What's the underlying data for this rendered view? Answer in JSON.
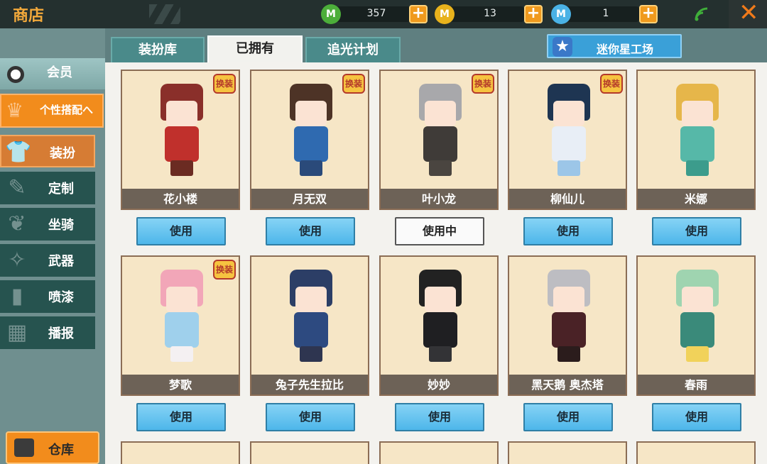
{
  "header": {
    "title": "商店",
    "currencies": [
      {
        "icon": "green-gem-icon",
        "symbol": "M",
        "value": "357",
        "color": "#4cae3a"
      },
      {
        "icon": "gold-coin-icon",
        "symbol": "M",
        "value": "13",
        "color": "#e8b21c"
      },
      {
        "icon": "blue-coin-icon",
        "symbol": "M",
        "value": "1",
        "color": "#4ab2e6"
      }
    ],
    "plus_label": "+",
    "close_label": "✕"
  },
  "sidebar": {
    "member_label": "会员",
    "group_label": "个性搭配へ",
    "items": [
      {
        "label": "装扮",
        "icon": "t-shirt-icon",
        "glyph": "👕"
      },
      {
        "label": "定制",
        "icon": "tools-icon",
        "glyph": "✎"
      },
      {
        "label": "坐骑",
        "icon": "mount-icon",
        "glyph": "❦"
      },
      {
        "label": "武器",
        "icon": "gun-icon",
        "glyph": "✧"
      },
      {
        "label": "喷漆",
        "icon": "spray-can-icon",
        "glyph": "▮"
      },
      {
        "label": "播报",
        "icon": "broadcast-icon",
        "glyph": "▦"
      }
    ],
    "warehouse_label": "仓库"
  },
  "tabs": [
    {
      "label": "装扮库",
      "active": false
    },
    {
      "label": "已拥有",
      "active": true
    },
    {
      "label": "追光计划",
      "active": false
    }
  ],
  "mini_star_button": {
    "label": "迷你星工场",
    "glyph": "★"
  },
  "badge_text": "换装",
  "skins": [
    {
      "name": "花小楼",
      "button": "使用",
      "in_use": false,
      "badge": true,
      "hair": "#8a2f2a",
      "body": "#c0302c",
      "legs": "#6b2b22"
    },
    {
      "name": "月无双",
      "button": "使用",
      "in_use": false,
      "badge": true,
      "hair": "#4d3326",
      "body": "#2f6ab0",
      "legs": "#2a4a7a"
    },
    {
      "name": "叶小龙",
      "button": "使用中",
      "in_use": true,
      "badge": true,
      "hair": "#a8a8ab",
      "body": "#3f3b38",
      "legs": "#4a4540"
    },
    {
      "name": "柳仙儿",
      "button": "使用",
      "in_use": false,
      "badge": true,
      "hair": "#1e3552",
      "body": "#e8eef6",
      "legs": "#9cc6e8"
    },
    {
      "name": "米娜",
      "button": "使用",
      "in_use": false,
      "badge": false,
      "hair": "#e6b64a",
      "body": "#56b8a8",
      "legs": "#3c9c8c"
    },
    {
      "name": "梦歌",
      "button": "使用",
      "in_use": false,
      "badge": true,
      "hair": "#f2a6b8",
      "body": "#9fd0ec",
      "legs": "#f4f0f2"
    },
    {
      "name": "兔子先生拉比",
      "button": "使用",
      "in_use": false,
      "badge": false,
      "hair": "#2c3e66",
      "body": "#2d4a80",
      "legs": "#2e3550"
    },
    {
      "name": "妙妙",
      "button": "使用",
      "in_use": false,
      "badge": false,
      "hair": "#222222",
      "body": "#1f1f22",
      "legs": "#333336"
    },
    {
      "name": "黑天鹅 奥杰塔",
      "button": "使用",
      "in_use": false,
      "badge": false,
      "hair": "#bdbdc2",
      "body": "#4a2226",
      "legs": "#2b1c1c"
    },
    {
      "name": "春雨",
      "button": "使用",
      "in_use": false,
      "badge": false,
      "hair": "#9fd4b0",
      "body": "#3a8a7a",
      "legs": "#f1d25a"
    }
  ]
}
